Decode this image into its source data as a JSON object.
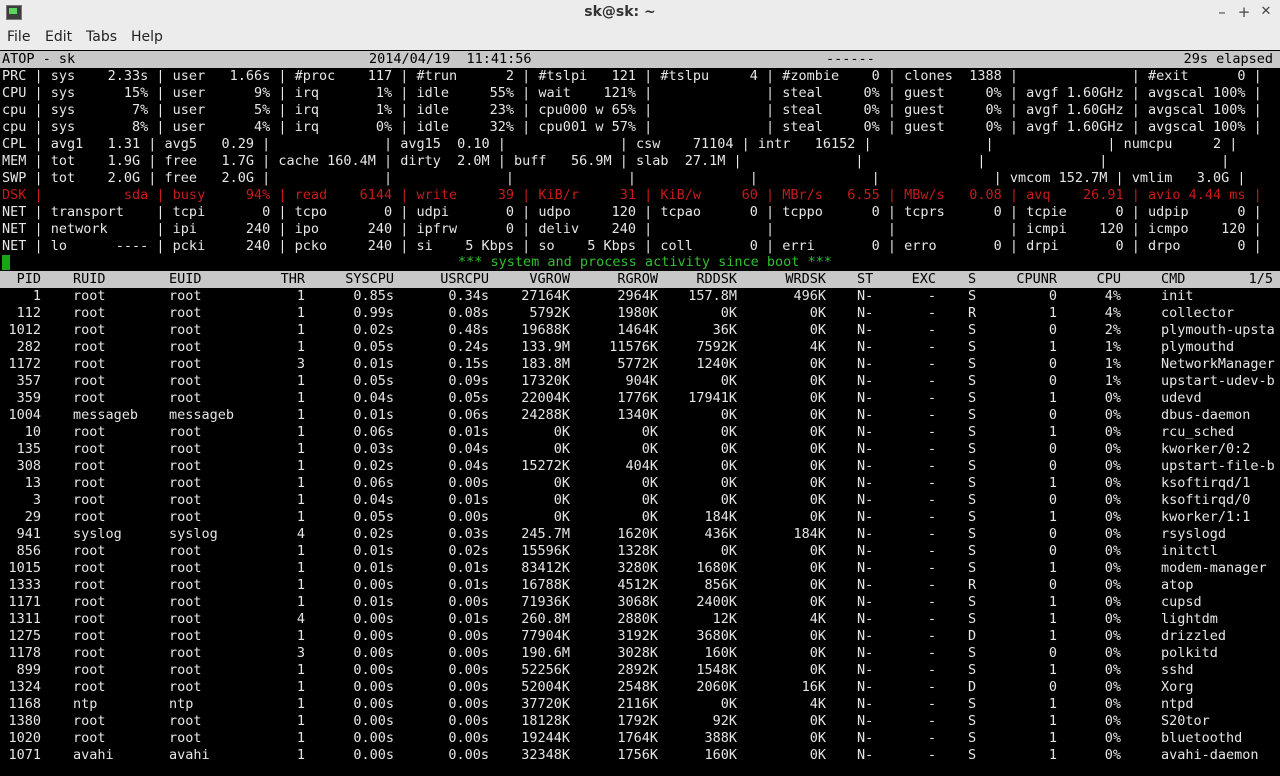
{
  "window": {
    "title": "sk@sk: ~",
    "minimize": "–",
    "maximize": "+",
    "close": "✕"
  },
  "menu": [
    "File",
    "Edit",
    "Tabs",
    "Help"
  ],
  "header": {
    "left": "ATOP - sk",
    "datetime": "2014/04/19  11:41:56",
    "dashes": "------",
    "elapsed": "29s elapsed"
  },
  "sys_lines": [
    "PRC | sys    2.33s | user   1.66s | #proc    117 | #trun      2 | #tslpi   121 | #tslpu     4 | #zombie    0 | clones  1388 |              | #exit      0 |",
    "CPU | sys      15% | user      9% | irq       1% | idle     55% | wait    121% |              | steal     0% | guest     0% | avgf 1.60GHz | avgscal 100% |",
    "cpu | sys       7% | user      5% | irq       1% | idle     23% | cpu000 w 65% |              | steal     0% | guest     0% | avgf 1.60GHz | avgscal 100% |",
    "cpu | sys       8% | user      4% | irq       0% | idle     32% | cpu001 w 57% |              | steal     0% | guest     0% | avgf 1.60GHz | avgscal 100% |",
    "CPL | avg1   1.31 | avg5   0.29 |              | avg15  0.10 |              | csw    71104 | intr   16152 |              |              | numcpu     2 |",
    "MEM | tot    1.9G | free   1.7G | cache 160.4M | dirty  2.0M | buff   56.9M | slab  27.1M |              |              |              |              |",
    "SWP | tot    2.0G | free   2.0G |              |              |              |              |              |              | vmcom 152.7M | vmlim   3.0G |",
    "DSK |          sda | busy     94% | read    6144 | write     39 | KiB/r     31 | KiB/w     60 | MBr/s   6.55 | MBw/s   0.08 | avq    26.91 | avio 4.44 ms |",
    "NET | transport    | tcpi       0 | tcpo       0 | udpi       0 | udpo     120 | tcpao      0 | tcppo      0 | tcprs      0 | tcpie      0 | udpip      0 |",
    "NET | network      | ipi      240 | ipo      240 | ipfrw      0 | deliv    240 |              |              |              | icmpi    120 | icmpo    120 |",
    "NET | lo      ---- | pcki     240 | pcko     240 | si    5 Kbps | so    5 Kbps | coll       0 | erri       0 | erro       0 | drpi       0 | drpo       0 |"
  ],
  "banner": "*** system and process activity since boot ***",
  "proc_header": [
    "PID",
    "RUID",
    "EUID",
    "THR",
    "SYSCPU",
    "USRCPU",
    "VGROW",
    "RGROW",
    "RDDSK",
    "WRDSK",
    "ST",
    "EXC",
    "S",
    "CPUNR",
    "CPU",
    "CMD",
    "1/5"
  ],
  "processes": [
    [
      "1",
      "root",
      "root",
      "1",
      "0.85s",
      "0.34s",
      "27164K",
      "2964K",
      "157.8M",
      "496K",
      "N-",
      "-",
      "S",
      "0",
      "4%",
      "init"
    ],
    [
      "112",
      "root",
      "root",
      "1",
      "0.99s",
      "0.08s",
      "5792K",
      "1980K",
      "0K",
      "0K",
      "N-",
      "-",
      "R",
      "1",
      "4%",
      "collector"
    ],
    [
      "1012",
      "root",
      "root",
      "1",
      "0.02s",
      "0.48s",
      "19688K",
      "1464K",
      "36K",
      "0K",
      "N-",
      "-",
      "S",
      "0",
      "2%",
      "plymouth-upsta"
    ],
    [
      "282",
      "root",
      "root",
      "1",
      "0.05s",
      "0.24s",
      "133.9M",
      "11576K",
      "7592K",
      "4K",
      "N-",
      "-",
      "S",
      "1",
      "1%",
      "plymouthd"
    ],
    [
      "1172",
      "root",
      "root",
      "3",
      "0.01s",
      "0.15s",
      "183.8M",
      "5772K",
      "1240K",
      "0K",
      "N-",
      "-",
      "S",
      "0",
      "1%",
      "NetworkManager"
    ],
    [
      "357",
      "root",
      "root",
      "1",
      "0.05s",
      "0.09s",
      "17320K",
      "904K",
      "0K",
      "0K",
      "N-",
      "-",
      "S",
      "0",
      "1%",
      "upstart-udev-b"
    ],
    [
      "359",
      "root",
      "root",
      "1",
      "0.04s",
      "0.05s",
      "22004K",
      "1776K",
      "17941K",
      "0K",
      "N-",
      "-",
      "S",
      "1",
      "0%",
      "udevd"
    ],
    [
      "1004",
      "messageb",
      "messageb",
      "1",
      "0.01s",
      "0.06s",
      "24288K",
      "1340K",
      "0K",
      "0K",
      "N-",
      "-",
      "S",
      "0",
      "0%",
      "dbus-daemon"
    ],
    [
      "10",
      "root",
      "root",
      "1",
      "0.06s",
      "0.01s",
      "0K",
      "0K",
      "0K",
      "0K",
      "N-",
      "-",
      "S",
      "1",
      "0%",
      "rcu_sched"
    ],
    [
      "135",
      "root",
      "root",
      "1",
      "0.03s",
      "0.04s",
      "0K",
      "0K",
      "0K",
      "0K",
      "N-",
      "-",
      "S",
      "0",
      "0%",
      "kworker/0:2"
    ],
    [
      "308",
      "root",
      "root",
      "1",
      "0.02s",
      "0.04s",
      "15272K",
      "404K",
      "0K",
      "0K",
      "N-",
      "-",
      "S",
      "0",
      "0%",
      "upstart-file-b"
    ],
    [
      "13",
      "root",
      "root",
      "1",
      "0.06s",
      "0.00s",
      "0K",
      "0K",
      "0K",
      "0K",
      "N-",
      "-",
      "S",
      "1",
      "0%",
      "ksoftirqd/1"
    ],
    [
      "3",
      "root",
      "root",
      "1",
      "0.04s",
      "0.01s",
      "0K",
      "0K",
      "0K",
      "0K",
      "N-",
      "-",
      "S",
      "0",
      "0%",
      "ksoftirqd/0"
    ],
    [
      "29",
      "root",
      "root",
      "1",
      "0.05s",
      "0.00s",
      "0K",
      "0K",
      "184K",
      "0K",
      "N-",
      "-",
      "S",
      "1",
      "0%",
      "kworker/1:1"
    ],
    [
      "941",
      "syslog",
      "syslog",
      "4",
      "0.02s",
      "0.03s",
      "245.7M",
      "1620K",
      "436K",
      "184K",
      "N-",
      "-",
      "S",
      "0",
      "0%",
      "rsyslogd"
    ],
    [
      "856",
      "root",
      "root",
      "1",
      "0.01s",
      "0.02s",
      "15596K",
      "1328K",
      "0K",
      "0K",
      "N-",
      "-",
      "S",
      "0",
      "0%",
      "initctl"
    ],
    [
      "1015",
      "root",
      "root",
      "1",
      "0.01s",
      "0.01s",
      "83412K",
      "3280K",
      "1680K",
      "0K",
      "N-",
      "-",
      "S",
      "1",
      "0%",
      "modem-manager"
    ],
    [
      "1333",
      "root",
      "root",
      "1",
      "0.00s",
      "0.01s",
      "16788K",
      "4512K",
      "856K",
      "0K",
      "N-",
      "-",
      "R",
      "0",
      "0%",
      "atop"
    ],
    [
      "1171",
      "root",
      "root",
      "1",
      "0.01s",
      "0.00s",
      "71936K",
      "3068K",
      "2400K",
      "0K",
      "N-",
      "-",
      "S",
      "1",
      "0%",
      "cupsd"
    ],
    [
      "1311",
      "root",
      "root",
      "4",
      "0.00s",
      "0.01s",
      "260.8M",
      "2880K",
      "12K",
      "4K",
      "N-",
      "-",
      "S",
      "1",
      "0%",
      "lightdm"
    ],
    [
      "1275",
      "root",
      "root",
      "1",
      "0.00s",
      "0.00s",
      "77904K",
      "3192K",
      "3680K",
      "0K",
      "N-",
      "-",
      "D",
      "1",
      "0%",
      "drizzled"
    ],
    [
      "1178",
      "root",
      "root",
      "3",
      "0.00s",
      "0.00s",
      "190.6M",
      "3028K",
      "160K",
      "0K",
      "N-",
      "-",
      "S",
      "0",
      "0%",
      "polkitd"
    ],
    [
      "899",
      "root",
      "root",
      "1",
      "0.00s",
      "0.00s",
      "52256K",
      "2892K",
      "1548K",
      "0K",
      "N-",
      "-",
      "S",
      "1",
      "0%",
      "sshd"
    ],
    [
      "1324",
      "root",
      "root",
      "1",
      "0.00s",
      "0.00s",
      "52004K",
      "2548K",
      "2060K",
      "16K",
      "N-",
      "-",
      "D",
      "0",
      "0%",
      "Xorg"
    ],
    [
      "1168",
      "ntp",
      "ntp",
      "1",
      "0.00s",
      "0.00s",
      "37720K",
      "2116K",
      "0K",
      "4K",
      "N-",
      "-",
      "S",
      "1",
      "0%",
      "ntpd"
    ],
    [
      "1380",
      "root",
      "root",
      "1",
      "0.00s",
      "0.00s",
      "18128K",
      "1792K",
      "92K",
      "0K",
      "N-",
      "-",
      "S",
      "1",
      "0%",
      "S20tor"
    ],
    [
      "1020",
      "root",
      "root",
      "1",
      "0.00s",
      "0.00s",
      "19244K",
      "1764K",
      "388K",
      "0K",
      "N-",
      "-",
      "S",
      "1",
      "0%",
      "bluetoothd"
    ],
    [
      "1071",
      "avahi",
      "avahi",
      "1",
      "0.00s",
      "0.00s",
      "32348K",
      "1756K",
      "160K",
      "0K",
      "N-",
      "-",
      "S",
      "1",
      "0%",
      "avahi-daemon"
    ]
  ],
  "colors": {
    "title_bg": "#ececec",
    "terminal_bg": "#000000",
    "text": "#e6e6e6",
    "band": "#c8c8c8",
    "alert_red": "#c81a1a",
    "banner_green": "#2fbf2f"
  }
}
